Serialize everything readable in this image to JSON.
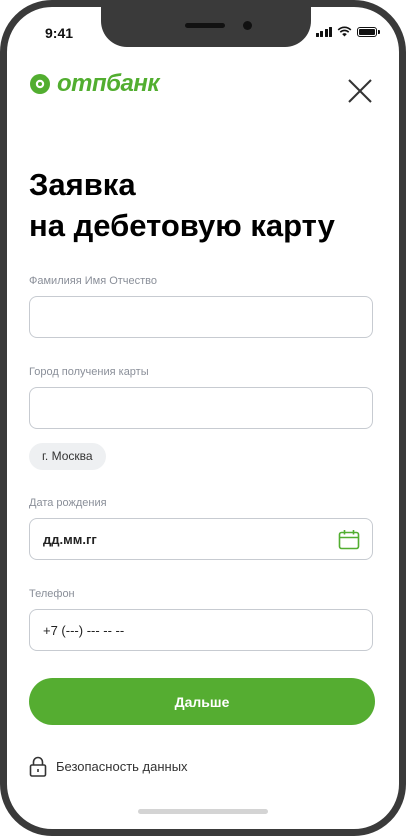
{
  "status_bar": {
    "time": "9:41"
  },
  "header": {
    "brand": "отпбанк",
    "brand_color": "#52ae30",
    "close_icon": "close-icon"
  },
  "page": {
    "title_line1": "Заявка",
    "title_line2": "на дебетовую карту"
  },
  "form": {
    "full_name": {
      "label": "Фамилияя Имя Отчество",
      "value": ""
    },
    "city": {
      "label": "Город получения карты",
      "value": "",
      "suggestion": "г. Москва"
    },
    "birth_date": {
      "label": "Дата рождения",
      "placeholder": "дд.мм.гг",
      "icon": "calendar-icon"
    },
    "phone": {
      "label": "Телефон",
      "placeholder": "+7 (---) --- -- --"
    }
  },
  "actions": {
    "next_label": "Дальше",
    "accent_color": "#55ad31"
  },
  "footer": {
    "security_label": "Безопасность данных",
    "icon": "lock-icon"
  }
}
